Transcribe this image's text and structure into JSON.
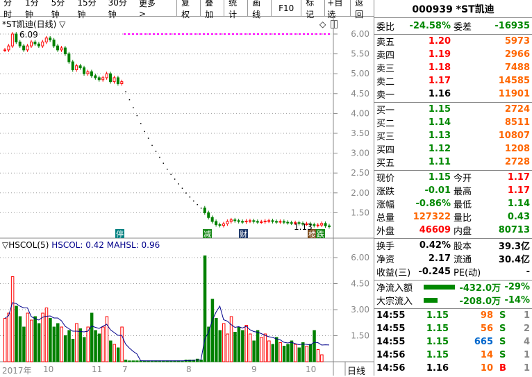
{
  "toolbar": {
    "periods": [
      "分时",
      "1分钟",
      "5分钟",
      "15分钟",
      "30分钟",
      "更多 >"
    ],
    "buttons": [
      "复权",
      "叠加",
      "统计",
      "画线",
      "F10",
      "标记",
      "+自选",
      "返回"
    ]
  },
  "chart": {
    "title": "*ST凯迪(日线) ▽",
    "high_label": "6.09",
    "last_label": "1.13",
    "price_ticks": [
      "6.00",
      "5.50",
      "5.00",
      "4.50",
      "4.00",
      "3.50",
      "3.00",
      "2.50",
      "2.00",
      "1.50"
    ],
    "indicator": {
      "name": "▽HSCOL(5)",
      "hscol": "HSCOL: 0.42",
      "mahsl": "MAHSL: 0.96"
    },
    "vol_ticks": [
      "6.00",
      "4.50",
      "3.00",
      "1.50"
    ],
    "date_labels": [
      "2017年",
      "10",
      "11",
      "7",
      "8",
      "9",
      "10"
    ],
    "period_label": "日线",
    "markers": [
      {
        "char": "停",
        "color": "#008080"
      },
      {
        "char": "减",
        "color": "#1a8a1a"
      },
      {
        "char": "财",
        "color": "#1f3a6b"
      },
      {
        "char": "楼",
        "color": "#7a4a1a"
      },
      {
        "char": "跌",
        "color": "#1a8a1a"
      }
    ],
    "icons": [
      "diamond-icon",
      "panel-icon"
    ]
  },
  "chart_data": {
    "type": "candlestick",
    "closes": [
      5.6,
      5.7,
      6.0,
      5.8,
      5.7,
      5.6,
      5.7,
      5.8,
      5.75,
      5.7,
      5.8,
      5.9,
      5.85,
      5.7,
      5.6,
      5.65,
      5.5,
      5.3,
      5.1,
      5.2,
      5.15,
      5.0,
      5.05,
      4.95,
      4.9,
      4.85,
      4.9,
      5.0,
      4.8,
      4.9,
      4.75,
      4.8,
      4.55,
      4.35,
      4.15,
      3.95,
      3.75,
      3.55,
      3.38,
      3.2,
      3.05,
      2.9,
      2.75,
      2.6,
      2.47,
      2.35,
      2.23,
      2.12,
      2.0,
      1.9,
      1.8,
      1.71,
      1.62,
      1.5,
      1.38,
      1.28,
      1.2,
      1.18,
      1.22,
      1.28,
      1.32,
      1.3,
      1.28,
      1.27,
      1.29,
      1.3,
      1.28,
      1.27,
      1.27,
      1.29,
      1.3,
      1.28,
      1.27,
      1.28,
      1.26,
      1.25,
      1.24,
      1.25,
      1.23,
      1.22,
      1.22,
      1.2,
      1.18,
      1.19,
      1.23,
      1.17,
      1.15
    ],
    "turnover": [
      2.5,
      2.8,
      4.9,
      3.2,
      2.6,
      2.0,
      2.8,
      2.4,
      2.6,
      2.2,
      2.8,
      3.1,
      2.5,
      2.0,
      2.2,
      2.0,
      1.5,
      1.8,
      1.3,
      2.2,
      1.9,
      1.4,
      2.0,
      2.8,
      1.8,
      1.6,
      2.0,
      2.6,
      1.2,
      1.0,
      0.8,
      2.0,
      0.1,
      0.05,
      0.05,
      0.05,
      0.05,
      0.05,
      0.05,
      0.05,
      0.05,
      0.05,
      0.05,
      0.05,
      0.05,
      0.05,
      0.05,
      0.05,
      0.1,
      0.1,
      0.1,
      0.15,
      0.1,
      6.1,
      2.0,
      3.6,
      2.5,
      1.8,
      2.2,
      1.6,
      2.6,
      1.7,
      2.0,
      1.8,
      2.1,
      1.6,
      1.2,
      1.8,
      1.4,
      1.6,
      1.2,
      1.0,
      1.4,
      1.1,
      0.9,
      1.0,
      1.2,
      1.0,
      0.8,
      1.1,
      0.9,
      1.0,
      1.8,
      0.7,
      0.4
    ],
    "ylim": [
      1.0,
      6.2
    ],
    "vol_ylim": [
      0,
      6.6
    ]
  },
  "quote": {
    "code_name": "000939 *ST凯迪",
    "wb_label": "委比",
    "wb": "-24.58%",
    "wc_label": "委差",
    "wc": "-16935",
    "sell": [
      [
        "卖五",
        "1.20",
        "5973"
      ],
      [
        "卖四",
        "1.19",
        "2966"
      ],
      [
        "卖三",
        "1.18",
        "7488"
      ],
      [
        "卖二",
        "1.17",
        "14585"
      ],
      [
        "卖一",
        "1.16",
        "11901"
      ]
    ],
    "buy": [
      [
        "买一",
        "1.15",
        "2724"
      ],
      [
        "买二",
        "1.14",
        "8511"
      ],
      [
        "买三",
        "1.13",
        "10807"
      ],
      [
        "买四",
        "1.12",
        "1208"
      ],
      [
        "买五",
        "1.11",
        "2728"
      ]
    ],
    "stats": [
      [
        "现价",
        "1.15",
        "今开",
        "1.17"
      ],
      [
        "涨跌",
        "-0.01",
        "最高",
        "1.17"
      ],
      [
        "涨幅",
        "-0.86%",
        "最低",
        "1.14"
      ],
      [
        "总量",
        "127322",
        "量比",
        "0.43"
      ],
      [
        "外盘",
        "46609",
        "内盘",
        "80713"
      ]
    ],
    "fund": [
      [
        "换手",
        "0.42%",
        "股本",
        "39.3亿"
      ],
      [
        "净资",
        "2.17",
        "流通",
        "30.4亿"
      ],
      [
        "收益(三)",
        "-0.245",
        "PE(动)",
        "-"
      ]
    ],
    "flow": [
      [
        "净流入额",
        "-432.0万",
        "-29%"
      ],
      [
        "大宗流入",
        "-208.0万",
        "-14%"
      ]
    ],
    "ticks": [
      [
        "14:55",
        "1.15",
        "98",
        "S",
        "1"
      ],
      [
        "14:55",
        "1.15",
        "56",
        "S",
        "2"
      ],
      [
        "14:55",
        "1.15",
        "665",
        "S",
        "4"
      ],
      [
        "14:56",
        "1.15",
        "14",
        "S",
        "1"
      ],
      [
        "14:56",
        "1.16",
        "10",
        "B",
        "1"
      ]
    ]
  },
  "colors": {
    "up": "#ff0000",
    "down": "#008000",
    "ma": "#00008b",
    "limit": "#ff00ff"
  }
}
